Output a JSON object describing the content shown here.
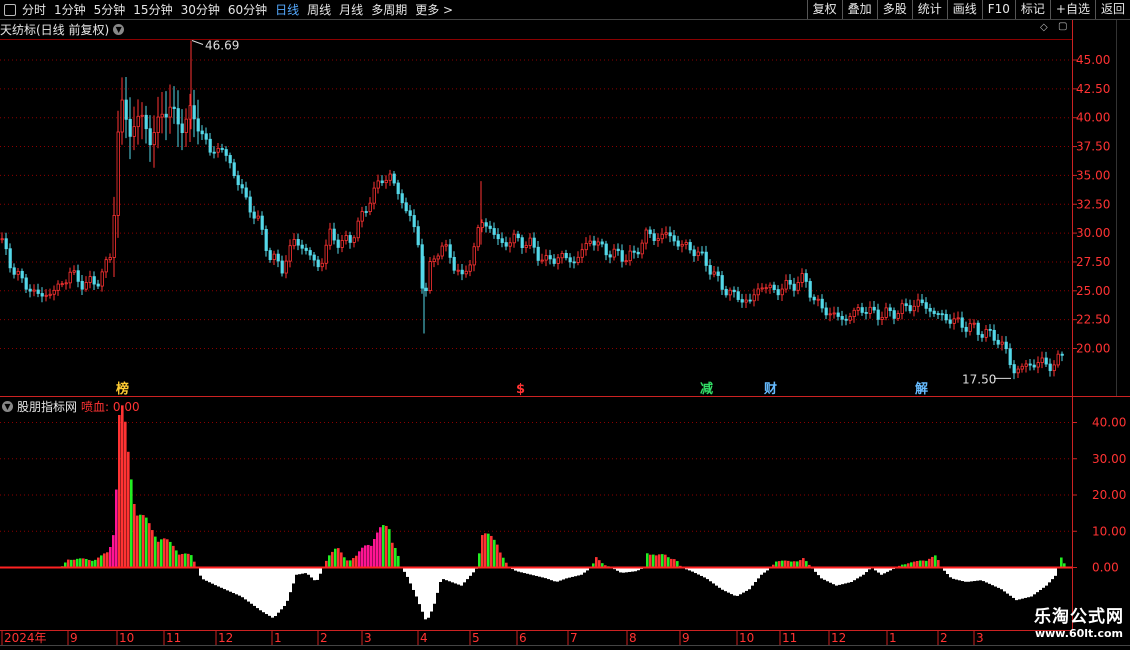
{
  "toolbar": {
    "periods": [
      "分时",
      "1分钟",
      "5分钟",
      "15分钟",
      "30分钟",
      "60分钟",
      "日线",
      "周线",
      "月线",
      "多周期",
      "更多 >"
    ],
    "active_index": 6,
    "right_buttons": [
      "复权",
      "叠加",
      "多股",
      "统计",
      "画线",
      "F10",
      "标记",
      "+自选",
      "返回"
    ]
  },
  "main_panel": {
    "title": "天纺标(日线 前复权)",
    "high_label": "46.69",
    "low_label": "17.50",
    "y_ticks": [
      "45.00",
      "42.50",
      "40.00",
      "37.50",
      "35.00",
      "32.50",
      "30.00",
      "27.50",
      "25.00",
      "22.50",
      "20.00"
    ],
    "markers": [
      {
        "text": "榜",
        "color": "#ffcc33"
      },
      {
        "text": "$",
        "color": "#ff3333"
      },
      {
        "text": "减",
        "color": "#33dd66"
      },
      {
        "text": "财",
        "color": "#66bbff"
      },
      {
        "text": "解",
        "color": "#66bbff"
      }
    ]
  },
  "sub_panel": {
    "title": "股朋指标网",
    "value_label": "喷血: 0.00",
    "y_ticks": [
      "40.00",
      "30.00",
      "20.00",
      "10.00",
      "0.00"
    ]
  },
  "time_axis": [
    "2024年",
    "9",
    "10",
    "11",
    "12",
    "1",
    "2",
    "3",
    "4",
    "5",
    "6",
    "7",
    "8",
    "9",
    "10",
    "11",
    "12",
    "1",
    "2",
    "3"
  ],
  "watermark": {
    "line1": "乐淘公式网",
    "line2": "www.60lt.com"
  },
  "colors": {
    "up": "#ff3333",
    "down": "#54d8e8",
    "green": "#22ee22",
    "pink": "#ff1493",
    "grid": "#8b0000",
    "axis": "#cc2222"
  },
  "chart_data": [
    {
      "type": "candlestick",
      "title": "天纺标(日线 前复权)",
      "ylim": [
        17.5,
        46.69
      ],
      "y_ticks": [
        20.0,
        22.5,
        25.0,
        27.5,
        30.0,
        32.5,
        35.0,
        37.5,
        40.0,
        42.5,
        45.0
      ],
      "annotations": [
        {
          "label": "46.69",
          "type": "max"
        },
        {
          "label": "17.50",
          "type": "min"
        }
      ],
      "close_path": [
        [
          0,
          29.5
        ],
        [
          12,
          27.0
        ],
        [
          25,
          25.5
        ],
        [
          40,
          24.5
        ],
        [
          55,
          25.0
        ],
        [
          70,
          26.5
        ],
        [
          85,
          25.5
        ],
        [
          100,
          26.0
        ],
        [
          112,
          28.5
        ],
        [
          120,
          42.0
        ],
        [
          130,
          38.5
        ],
        [
          140,
          40.5
        ],
        [
          150,
          38.0
        ],
        [
          160,
          40.0
        ],
        [
          170,
          41.0
        ],
        [
          180,
          39.0
        ],
        [
          190,
          40.5
        ],
        [
          200,
          39.0
        ],
        [
          210,
          37.0
        ],
        [
          220,
          37.5
        ],
        [
          230,
          36.0
        ],
        [
          245,
          33.0
        ],
        [
          258,
          31.0
        ],
        [
          270,
          28.0
        ],
        [
          282,
          27.0
        ],
        [
          295,
          29.5
        ],
        [
          310,
          28.0
        ],
        [
          320,
          27.0
        ],
        [
          330,
          30.0
        ],
        [
          340,
          29.0
        ],
        [
          350,
          29.5
        ],
        [
          360,
          31.0
        ],
        [
          370,
          33.0
        ],
        [
          380,
          34.5
        ],
        [
          390,
          35.0
        ],
        [
          400,
          33.0
        ],
        [
          410,
          31.5
        ],
        [
          418,
          29.0
        ],
        [
          424,
          24.0
        ],
        [
          430,
          27.0
        ],
        [
          440,
          29.0
        ],
        [
          450,
          28.0
        ],
        [
          462,
          26.0
        ],
        [
          472,
          28.0
        ],
        [
          480,
          31.0
        ],
        [
          490,
          30.5
        ],
        [
          500,
          29.0
        ],
        [
          515,
          29.5
        ],
        [
          530,
          29.0
        ],
        [
          545,
          27.5
        ],
        [
          560,
          28.0
        ],
        [
          575,
          27.5
        ],
        [
          590,
          29.5
        ],
        [
          605,
          28.5
        ],
        [
          620,
          28.0
        ],
        [
          635,
          28.0
        ],
        [
          645,
          30.0
        ],
        [
          655,
          29.5
        ],
        [
          665,
          30.0
        ],
        [
          680,
          29.0
        ],
        [
          695,
          28.5
        ],
        [
          710,
          27.0
        ],
        [
          720,
          25.5
        ],
        [
          735,
          24.5
        ],
        [
          750,
          24.0
        ],
        [
          760,
          25.5
        ],
        [
          775,
          25.0
        ],
        [
          790,
          25.5
        ],
        [
          805,
          26.0
        ],
        [
          815,
          24.0
        ],
        [
          830,
          23.0
        ],
        [
          845,
          22.5
        ],
        [
          860,
          23.5
        ],
        [
          875,
          23.0
        ],
        [
          890,
          23.0
        ],
        [
          905,
          23.5
        ],
        [
          920,
          24.0
        ],
        [
          935,
          23.0
        ],
        [
          950,
          22.5
        ],
        [
          965,
          22.0
        ],
        [
          980,
          21.5
        ],
        [
          995,
          21.0
        ],
        [
          1005,
          20.0
        ],
        [
          1013,
          18.0
        ],
        [
          1025,
          18.5
        ],
        [
          1040,
          18.8
        ],
        [
          1055,
          18.5
        ],
        [
          1062,
          19.5
        ]
      ]
    },
    {
      "type": "histogram",
      "title": "股朋指标网",
      "series": [
        {
          "name": "喷血",
          "values": [
            0.0
          ]
        }
      ],
      "ylim": [
        -15,
        45
      ],
      "y_ticks": [
        0.0,
        10.0,
        20.0,
        30.0,
        40.0
      ],
      "bar_path": [
        [
          0,
          0
        ],
        [
          60,
          0
        ],
        [
          68,
          2.5
        ],
        [
          90,
          2.0
        ],
        [
          100,
          3.0
        ],
        [
          108,
          4.0
        ],
        [
          112,
          10.0
        ],
        [
          115,
          25.0
        ],
        [
          118,
          42.0
        ],
        [
          122,
          40.0
        ],
        [
          126,
          30.0
        ],
        [
          132,
          20.0
        ],
        [
          140,
          14.0
        ],
        [
          150,
          10.0
        ],
        [
          160,
          8.0
        ],
        [
          170,
          6.0
        ],
        [
          180,
          4.0
        ],
        [
          190,
          3.0
        ],
        [
          196,
          0
        ],
        [
          200,
          -3.0
        ],
        [
          215,
          -5.0
        ],
        [
          240,
          -8.0
        ],
        [
          260,
          -12.0
        ],
        [
          272,
          -14.0
        ],
        [
          285,
          -10.0
        ],
        [
          295,
          -2.0
        ],
        [
          305,
          -1.5
        ],
        [
          315,
          -4.0
        ],
        [
          322,
          0
        ],
        [
          328,
          4.0
        ],
        [
          336,
          5.0
        ],
        [
          345,
          2.0
        ],
        [
          355,
          3.0
        ],
        [
          365,
          6.0
        ],
        [
          372,
          8.0
        ],
        [
          380,
          10.0
        ],
        [
          388,
          11.0
        ],
        [
          396,
          4.0
        ],
        [
          400,
          0
        ],
        [
          405,
          -2.0
        ],
        [
          415,
          -8.0
        ],
        [
          425,
          -15.0
        ],
        [
          432,
          -11.0
        ],
        [
          440,
          -3.0
        ],
        [
          450,
          -4.0
        ],
        [
          460,
          -5.0
        ],
        [
          470,
          -2.0
        ],
        [
          476,
          0
        ],
        [
          480,
          9.0
        ],
        [
          488,
          8.0
        ],
        [
          496,
          7.0
        ],
        [
          503,
          2.0
        ],
        [
          508,
          0
        ],
        [
          515,
          -1.0
        ],
        [
          530,
          -2.0
        ],
        [
          545,
          -3.0
        ],
        [
          555,
          -4.0
        ],
        [
          565,
          -3.0
        ],
        [
          580,
          -2.0
        ],
        [
          590,
          0
        ],
        [
          595,
          2.5
        ],
        [
          602,
          1.0
        ],
        [
          610,
          0
        ],
        [
          620,
          -1.5
        ],
        [
          635,
          -1.0
        ],
        [
          643,
          0
        ],
        [
          646,
          4.5
        ],
        [
          655,
          3.0
        ],
        [
          665,
          3.5
        ],
        [
          675,
          2.0
        ],
        [
          680,
          0
        ],
        [
          690,
          -1.0
        ],
        [
          705,
          -3.0
        ],
        [
          720,
          -6.0
        ],
        [
          735,
          -8.0
        ],
        [
          748,
          -6.0
        ],
        [
          760,
          -2.0
        ],
        [
          770,
          0
        ],
        [
          775,
          2.0
        ],
        [
          790,
          1.5
        ],
        [
          802,
          2.5
        ],
        [
          810,
          0
        ],
        [
          820,
          -3.0
        ],
        [
          835,
          -5.0
        ],
        [
          850,
          -4.0
        ],
        [
          862,
          -2.0
        ],
        [
          870,
          0
        ],
        [
          880,
          -2.0
        ],
        [
          895,
          0
        ],
        [
          902,
          1.0
        ],
        [
          915,
          1.5
        ],
        [
          928,
          2.5
        ],
        [
          935,
          3.0
        ],
        [
          940,
          0
        ],
        [
          950,
          -3.0
        ],
        [
          965,
          -4.0
        ],
        [
          980,
          -3.5
        ],
        [
          1000,
          -6.0
        ],
        [
          1015,
          -9.0
        ],
        [
          1030,
          -8.0
        ],
        [
          1045,
          -5.0
        ],
        [
          1055,
          -2.0
        ],
        [
          1060,
          2.5
        ],
        [
          1065,
          0
        ]
      ]
    }
  ]
}
